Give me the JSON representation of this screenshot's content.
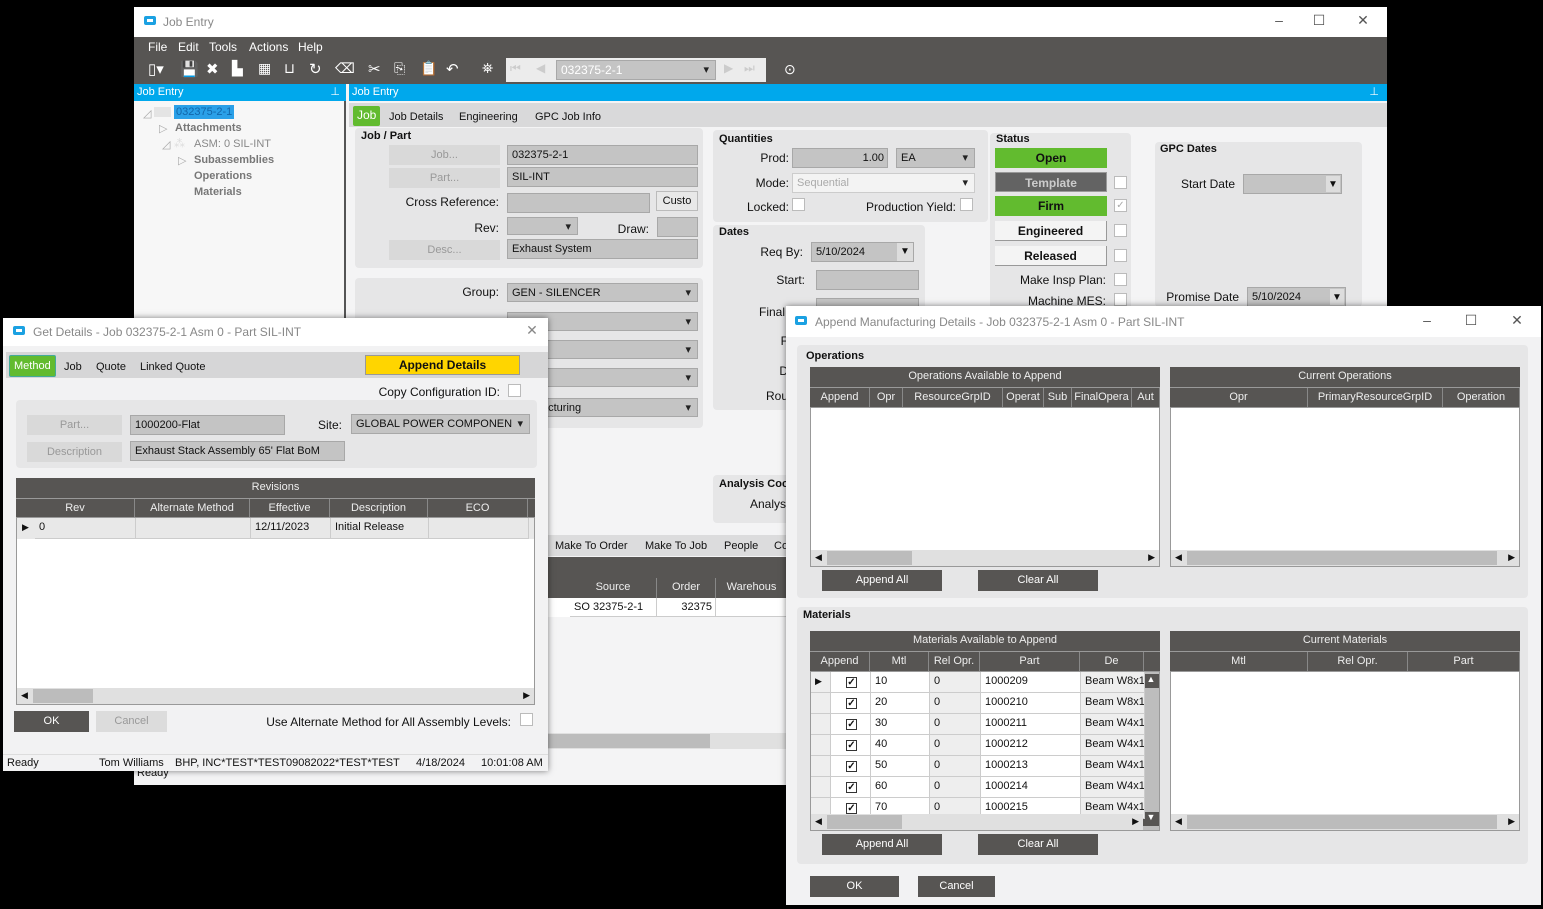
{
  "main": {
    "title": "Job Entry",
    "menu": [
      "File",
      "Edit",
      "Tools",
      "Actions",
      "Help"
    ],
    "job_combo": "032375-2-1",
    "left_header": "Job Entry",
    "right_header": "Job Entry",
    "tree": {
      "root": "032375-2-1",
      "attachments": "Attachments",
      "asm": "ASM: 0 SIL-INT",
      "subassemblies": "Subassemblies",
      "operations": "Operations",
      "materials": "Materials"
    },
    "tabs": [
      "Job",
      "Job Details",
      "Engineering",
      "GPC Job Info"
    ],
    "jobpart": {
      "title": "Job / Part",
      "job_btn": "Job...",
      "job": "032375-2-1",
      "part_btn": "Part...",
      "part": "SIL-INT",
      "cross_ref_label": "Cross Reference:",
      "custo": "Custo",
      "rev_label": "Rev:",
      "draw_label": "Draw:",
      "desc_btn": "Desc...",
      "desc": "Exhaust System"
    },
    "group_label": "Group:",
    "group": "GEN - SILENCER",
    "manuf_partial": "acturing",
    "quantities": {
      "title": "Quantities",
      "prod_label": "Prod:",
      "prod": "1.00",
      "uom": "EA",
      "mode_label": "Mode:",
      "mode": "Sequential",
      "locked_label": "Locked:",
      "yield_label": "Production Yield:"
    },
    "dates": {
      "title": "Dates",
      "reqby_label": "Req By:",
      "reqby": "5/10/2024",
      "start_label": "Start:",
      "final_label": "Final",
      "f_label": "F",
      "d_label": "D",
      "rou_label": "Rou"
    },
    "status": {
      "title": "Status",
      "open": "Open",
      "template": "Template",
      "firm": "Firm",
      "firm_checked": true,
      "engineered": "Engineered",
      "released": "Released",
      "insp_label": "Make Insp Plan:",
      "mes_label": "Machine MES:"
    },
    "gpc": {
      "title": "GPC Dates",
      "start_label": "Start Date",
      "promise_label": "Promise Date",
      "promise": "5/10/2024"
    },
    "analysis": {
      "title": "Analysis Coc",
      "label": "Analys"
    },
    "lower_tabs": [
      "Make To Order",
      "Make To Job",
      "People",
      "Co"
    ],
    "grid": {
      "cols": [
        "Source",
        "Order",
        "Warehous"
      ],
      "row": [
        "SO 32375-2-1",
        "32375",
        ""
      ]
    },
    "statusbar": "Ready"
  },
  "get": {
    "title": "Get Details - Job 032375-2-1 Asm 0 - Part SIL-INT",
    "tabs": [
      "Method",
      "Job",
      "Quote",
      "Linked Quote"
    ],
    "append": "Append Details",
    "copy_cfg": "Copy Configuration ID:",
    "part_btn": "Part...",
    "part": "1000200-Flat",
    "site_label": "Site:",
    "site": "GLOBAL POWER COMPONEN",
    "desc_btn": "Description",
    "desc": "Exhaust Stack Assembly 65' Flat BoM",
    "rev_title": "Revisions",
    "rev_cols": [
      "Rev",
      "Alternate Method",
      "Effective",
      "Description",
      "ECO"
    ],
    "rev_row": [
      "0",
      "",
      "12/11/2023",
      "Initial Release",
      ""
    ],
    "ok": "OK",
    "cancel": "Cancel",
    "alt_label": "Use Alternate Method for All Assembly Levels:",
    "status": {
      "state": "Ready",
      "user": "Tom Williams",
      "company": "BHP, INC*TEST*TEST09082022*TEST*TEST",
      "date": "4/18/2024",
      "time": "10:01:08 AM"
    }
  },
  "append": {
    "title": "Append Manufacturing Details - Job 032375-2-1 Asm 0 - Part SIL-INT",
    "ops_title": "Operations",
    "ops_avail": "Operations Available to Append",
    "ops_avail_cols": [
      "Append",
      "Opr",
      "ResourceGrpID",
      "Operat",
      "Sub",
      "FinalOpera",
      "Aut"
    ],
    "ops_cur": "Current Operations",
    "ops_cur_cols": [
      "Opr",
      "PrimaryResourceGrpID",
      "Operation"
    ],
    "append_all": "Append All",
    "clear_all": "Clear All",
    "mtl_title": "Materials",
    "mtl_avail": "Materials Available to Append",
    "mtl_avail_cols": [
      "Append",
      "Mtl",
      "Rel Opr.",
      "Part",
      "De"
    ],
    "mtl_rows": [
      [
        "10",
        "0",
        "1000209",
        "Beam W8x1"
      ],
      [
        "20",
        "0",
        "1000210",
        "Beam W8x1"
      ],
      [
        "30",
        "0",
        "1000211",
        "Beam W4x1"
      ],
      [
        "40",
        "0",
        "1000212",
        "Beam W4x1"
      ],
      [
        "50",
        "0",
        "1000213",
        "Beam W4x1"
      ],
      [
        "60",
        "0",
        "1000214",
        "Beam W4x1"
      ],
      [
        "70",
        "0",
        "1000215",
        "Beam W4x1"
      ]
    ],
    "mtl_cur": "Current Materials",
    "mtl_cur_cols": [
      "Mtl",
      "Rel Opr.",
      "Part"
    ],
    "ok": "OK",
    "cancel": "Cancel"
  },
  "colors": {
    "accent_blue": "#00a8ec",
    "green": "#62bb2f",
    "yellow": "#ffd500",
    "dark": "#575553"
  }
}
